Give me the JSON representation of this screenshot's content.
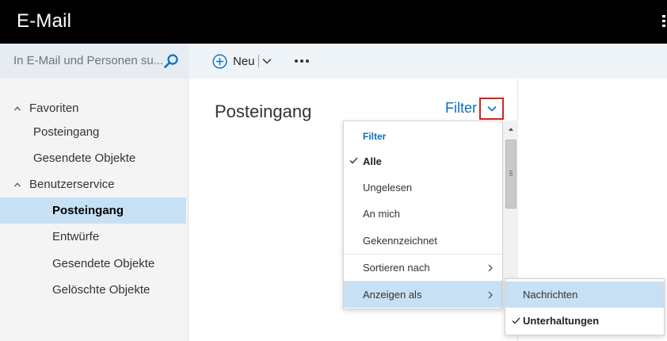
{
  "app": {
    "title": "E-Mail"
  },
  "search": {
    "placeholder": "In E-Mail und Personen su..."
  },
  "toolbar": {
    "new_label": "Neu"
  },
  "sidebar": {
    "favorites_label": "Favoriten",
    "favorites_items": [
      "Posteingang",
      "Gesendete Objekte"
    ],
    "account_label": "Benutzerservice",
    "account_items": [
      "Posteingang",
      "Entwürfe",
      "Gesendete Objekte",
      "Gelöschte Objekte"
    ],
    "selected_item": "Posteingang"
  },
  "list": {
    "folder_title": "Posteingang",
    "filter_label": "Filter"
  },
  "filter_menu": {
    "header": "Filter",
    "options": [
      "Alle",
      "Ungelesen",
      "An mich",
      "Gekennzeichnet"
    ],
    "checked_option": "Alle",
    "sort_label": "Sortieren nach",
    "view_label": "Anzeigen als"
  },
  "view_submenu": {
    "options": [
      "Nachrichten",
      "Unterhaltungen"
    ],
    "checked_option": "Unterhaltungen"
  },
  "colors": {
    "accent": "#0a6fc2",
    "selection": "#c7e0f4",
    "highlight_box": "#d9231e",
    "topbar": "#000000"
  }
}
